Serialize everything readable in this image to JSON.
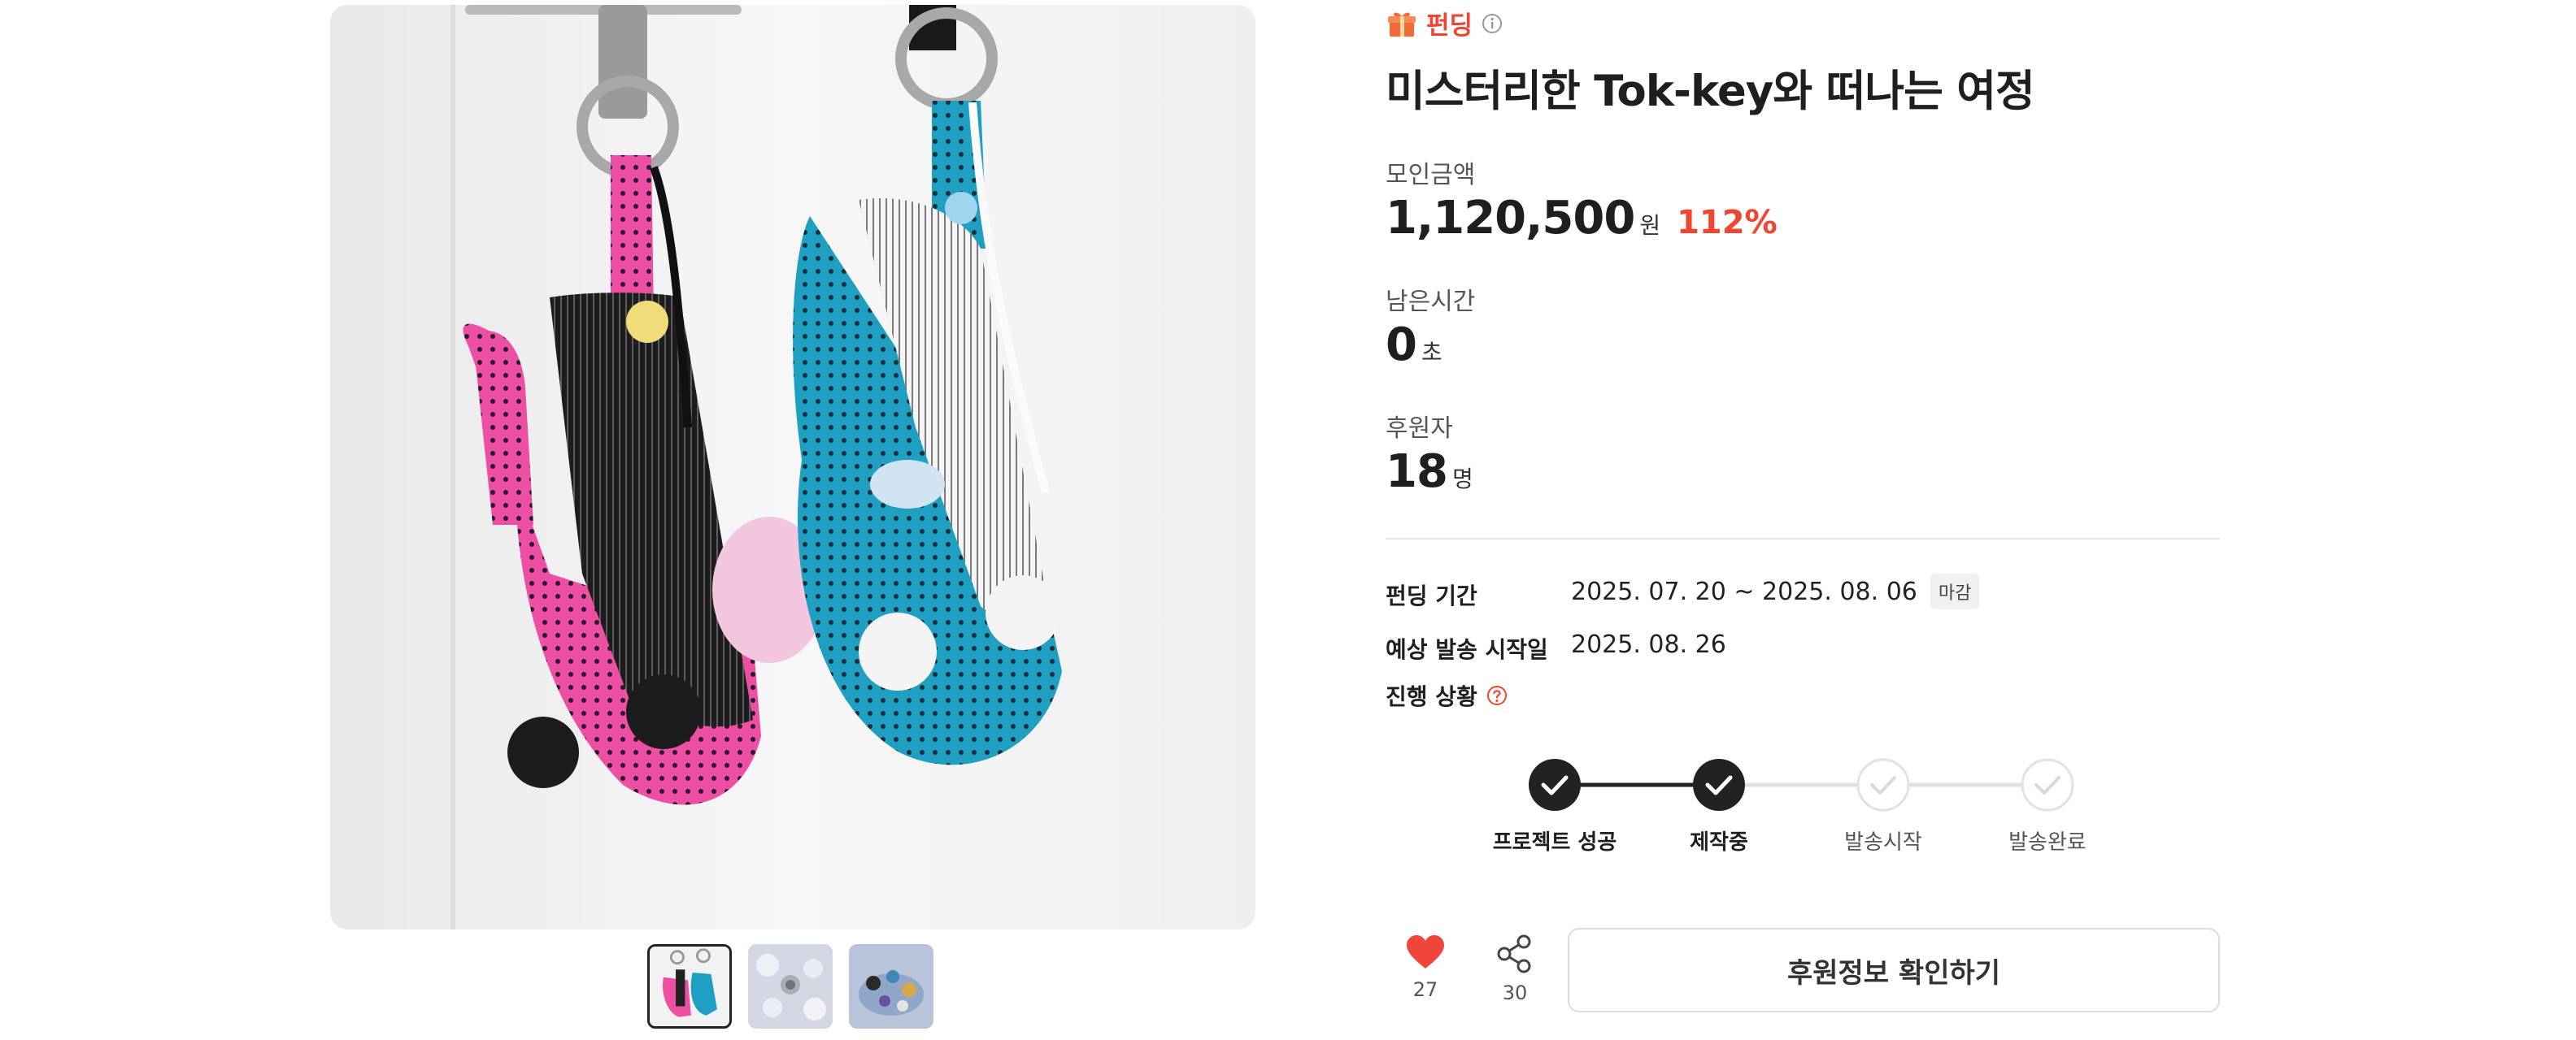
{
  "gallery": {
    "main_image": "pink-and-blue-polka-dot-rabbit-keyrings",
    "thumbnails": [
      "rabbit-keyrings-thumbnail",
      "metal-ring-thumbnail",
      "product-set-thumbnail"
    ],
    "selected_index": 0
  },
  "project": {
    "category_icon": "gift-icon",
    "category_label": "펀딩",
    "info_icon": "info-icon",
    "title": "미스터리한 Tok-key와 떠나는 여정"
  },
  "stats": {
    "amount_label": "모인금액",
    "amount_value": "1,120,500",
    "amount_unit": "원",
    "amount_percent": "112%",
    "time_label": "남은시간",
    "time_value": "0",
    "time_unit": "초",
    "backers_label": "후원자",
    "backers_value": "18",
    "backers_unit": "명"
  },
  "details": {
    "period_label": "펀딩 기간",
    "period_value": "2025. 07. 20 ~ 2025. 08. 06",
    "period_badge": "마감",
    "ship_label": "예상 발송 시작일",
    "ship_value": "2025. 08. 26",
    "status_label": "진행 상황",
    "status_help_icon": "question-circle-icon"
  },
  "progress_steps": [
    {
      "label": "프로젝트 성공",
      "done": true
    },
    {
      "label": "제작중",
      "done": true
    },
    {
      "label": "발송시작",
      "done": false
    },
    {
      "label": "발송완료",
      "done": false
    }
  ],
  "actions": {
    "like_icon": "heart-icon",
    "like_count": "27",
    "share_icon": "share-icon",
    "share_count": "30",
    "primary_label": "후원정보 확인하기"
  },
  "colors": {
    "accent": "#f0452f",
    "heart": "#f0453a",
    "step_done": "#222222",
    "step_todo": "#d9d9d9"
  }
}
